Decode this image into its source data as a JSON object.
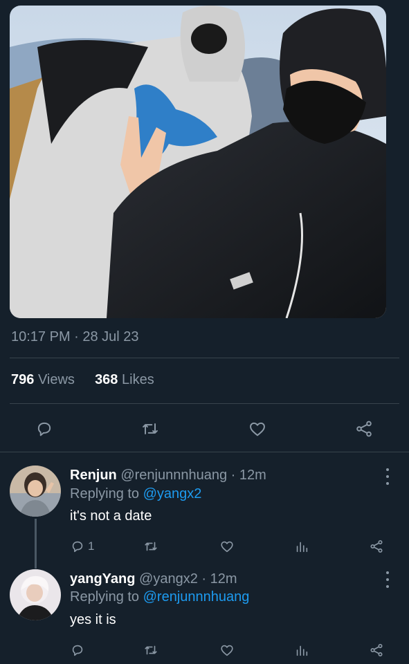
{
  "tweet": {
    "image_alt_icon": "selfie-photo",
    "timestamp": "10:17 PM · 28 Jul 23",
    "views_count": "796",
    "views_label": "Views",
    "likes_count": "368",
    "likes_label": "Likes"
  },
  "actions": {
    "icons": [
      "reply-icon",
      "retweet-icon",
      "like-icon",
      "share-icon"
    ]
  },
  "replies": [
    {
      "name": "Renjun",
      "meta": "@renjunnnhuang · 12m",
      "replying_prefix": "Replying to ",
      "replying_to": "@yangx2",
      "text": "it's not a date",
      "reply_count": "1"
    },
    {
      "name": "yangYang",
      "meta": "@yangx2 · 12m",
      "replying_prefix": "Replying to ",
      "replying_to": "@renjunnnhuang",
      "text": "yes it is",
      "reply_count": ""
    }
  ],
  "colors": {
    "background": "#15202b",
    "muted": "#8b98a5",
    "accent": "#1d9bf0",
    "divider": "#38444d"
  }
}
